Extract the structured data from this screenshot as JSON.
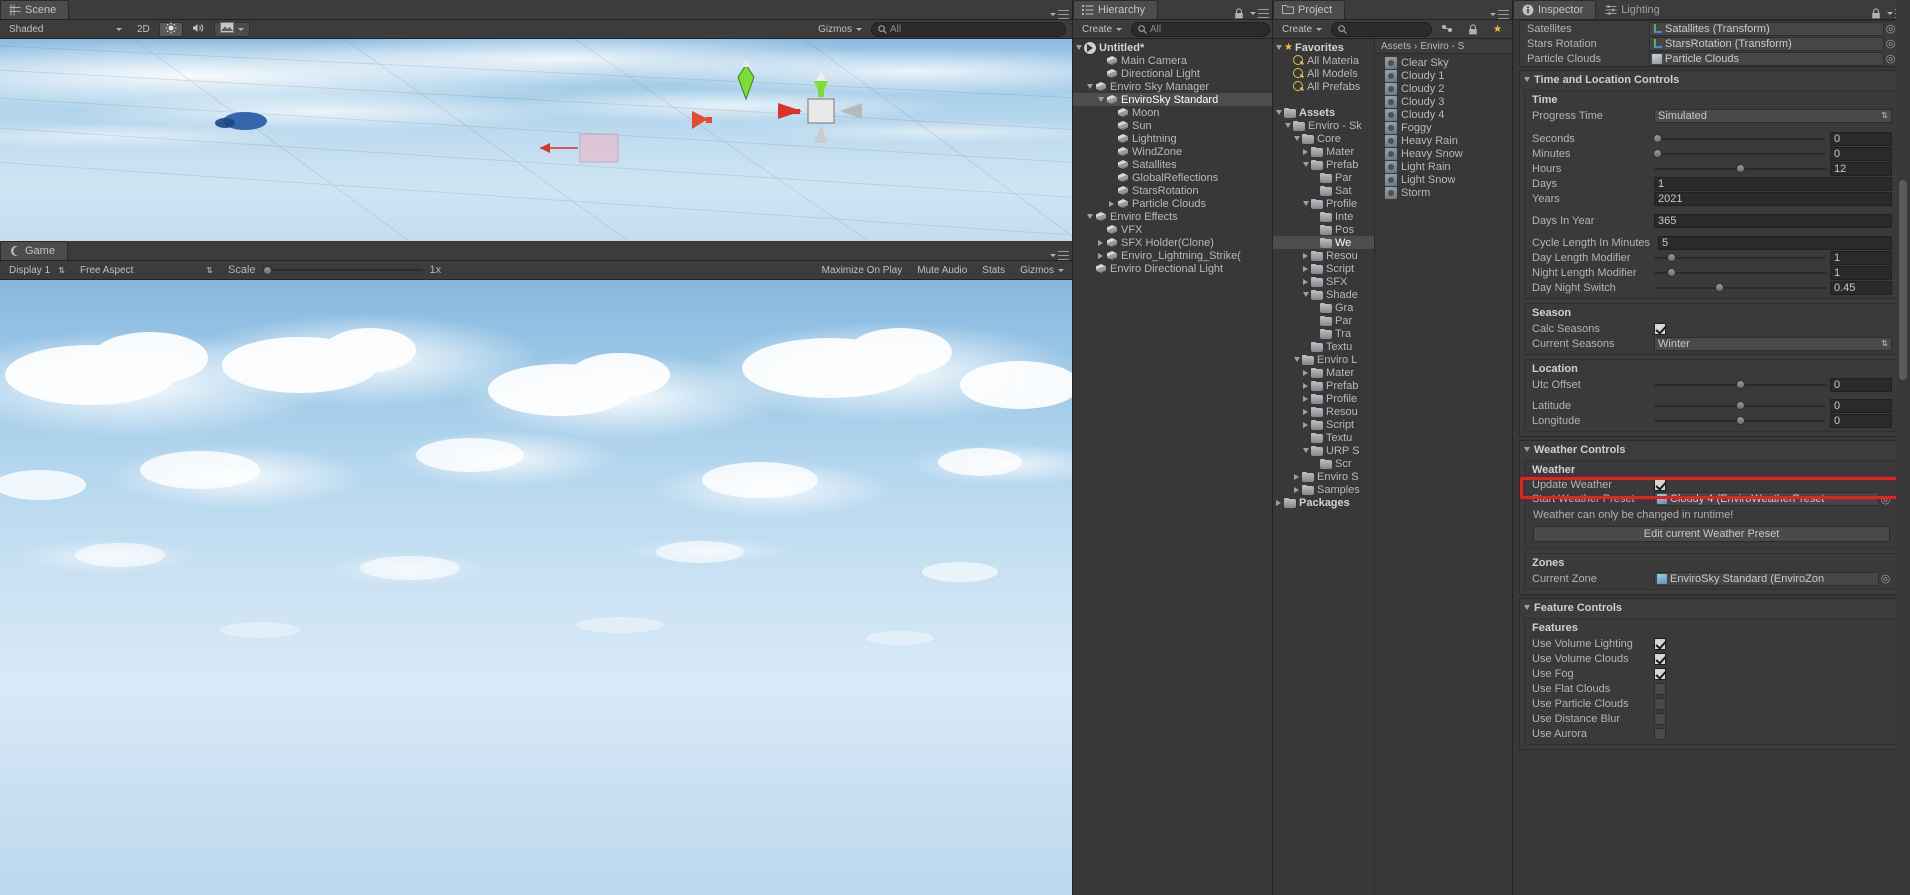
{
  "scene_view": {
    "tab_label": "Scene",
    "tab_icon": "scene-grid-icon",
    "draw_mode": "Shaded",
    "two_d_button": "2D",
    "lighting_icon": "sun-icon",
    "audio_icon": "speaker-icon",
    "fx_icon": "image-icon",
    "gizmos_label": "Gizmos",
    "search_placeholder": "All",
    "search_value": ""
  },
  "game_view": {
    "tab_label": "Game",
    "tab_icon": "gamepad-icon",
    "display": "Display 1",
    "aspect": "Free Aspect",
    "scale_label": "Scale",
    "scale_value": "1x",
    "maximize_on_play": "Maximize On Play",
    "mute_audio": "Mute Audio",
    "stats": "Stats",
    "gizmos": "Gizmos"
  },
  "hierarchy": {
    "tab_label": "Hierarchy",
    "tab_icon": "hierarchy-icon",
    "create_label": "Create",
    "search_placeholder": "All",
    "items": [
      {
        "label": "Untitled*",
        "depth": 0,
        "icon": "unity-scene-icon",
        "fold": "down",
        "selected": false,
        "bold": true
      },
      {
        "label": "Main Camera",
        "depth": 2,
        "icon": "gameobject-icon",
        "fold": "none",
        "selected": false
      },
      {
        "label": "Directional Light",
        "depth": 2,
        "icon": "gameobject-icon",
        "fold": "none",
        "selected": false
      },
      {
        "label": "Enviro Sky Manager",
        "depth": 1,
        "icon": "gameobject-icon",
        "fold": "down",
        "selected": false
      },
      {
        "label": "EnviroSky Standard",
        "depth": 2,
        "icon": "gameobject-icon",
        "fold": "down",
        "selected": true
      },
      {
        "label": "Moon",
        "depth": 3,
        "icon": "gameobject-icon",
        "fold": "none",
        "selected": false
      },
      {
        "label": "Sun",
        "depth": 3,
        "icon": "gameobject-icon",
        "fold": "none",
        "selected": false
      },
      {
        "label": "Lightning",
        "depth": 3,
        "icon": "gameobject-icon",
        "fold": "none",
        "selected": false
      },
      {
        "label": "WindZone",
        "depth": 3,
        "icon": "gameobject-icon",
        "fold": "none",
        "selected": false
      },
      {
        "label": "Satallites",
        "depth": 3,
        "icon": "gameobject-icon",
        "fold": "none",
        "selected": false
      },
      {
        "label": "GlobalReflections",
        "depth": 3,
        "icon": "gameobject-icon",
        "fold": "none",
        "selected": false
      },
      {
        "label": "StarsRotation",
        "depth": 3,
        "icon": "gameobject-icon",
        "fold": "none",
        "selected": false
      },
      {
        "label": "Particle Clouds",
        "depth": 3,
        "icon": "gameobject-icon",
        "fold": "right",
        "selected": false
      },
      {
        "label": "Enviro Effects",
        "depth": 1,
        "icon": "gameobject-icon",
        "fold": "down",
        "selected": false
      },
      {
        "label": "VFX",
        "depth": 2,
        "icon": "gameobject-icon",
        "fold": "none",
        "selected": false
      },
      {
        "label": "SFX Holder(Clone)",
        "depth": 2,
        "icon": "gameobject-icon",
        "fold": "right",
        "selected": false
      },
      {
        "label": "Enviro_Lightning_Strike(",
        "depth": 2,
        "icon": "gameobject-icon",
        "fold": "right",
        "selected": false
      },
      {
        "label": "Enviro Directional Light",
        "depth": 1,
        "icon": "gameobject-icon",
        "fold": "none",
        "selected": false
      }
    ]
  },
  "project": {
    "tab_label": "Project",
    "tab_icon": "folder-icon",
    "create_label": "Create",
    "search_placeholder": "",
    "breadcrumb": [
      "Assets",
      "Enviro - S"
    ],
    "tree": [
      {
        "label": "Favorites",
        "depth": 0,
        "icon": "star-icon",
        "fold": "down",
        "bold": true
      },
      {
        "label": "All Materia",
        "depth": 1,
        "icon": "search-icon",
        "fold": "none"
      },
      {
        "label": "All Models",
        "depth": 1,
        "icon": "search-icon",
        "fold": "none"
      },
      {
        "label": "All Prefabs",
        "depth": 1,
        "icon": "search-icon",
        "fold": "none"
      },
      {
        "label": "",
        "depth": 0,
        "icon": "none",
        "fold": "none"
      },
      {
        "label": "Assets",
        "depth": 0,
        "icon": "folder-icon",
        "fold": "down",
        "bold": true
      },
      {
        "label": "Enviro - Sk",
        "depth": 1,
        "icon": "folder-icon",
        "fold": "down"
      },
      {
        "label": "Core",
        "depth": 2,
        "icon": "folder-icon",
        "fold": "down"
      },
      {
        "label": "Mater",
        "depth": 3,
        "icon": "folder-icon",
        "fold": "right"
      },
      {
        "label": "Prefab",
        "depth": 3,
        "icon": "folder-icon",
        "fold": "down"
      },
      {
        "label": "Par",
        "depth": 4,
        "icon": "folder-icon",
        "fold": "none"
      },
      {
        "label": "Sat",
        "depth": 4,
        "icon": "folder-icon",
        "fold": "none"
      },
      {
        "label": "Profile",
        "depth": 3,
        "icon": "folder-icon",
        "fold": "down"
      },
      {
        "label": "Inte",
        "depth": 4,
        "icon": "folder-icon",
        "fold": "none"
      },
      {
        "label": "Pos",
        "depth": 4,
        "icon": "folder-icon",
        "fold": "none"
      },
      {
        "label": "We",
        "depth": 4,
        "icon": "folder-icon",
        "fold": "none",
        "selected": true
      },
      {
        "label": "Resou",
        "depth": 3,
        "icon": "folder-icon",
        "fold": "right"
      },
      {
        "label": "Script",
        "depth": 3,
        "icon": "folder-icon",
        "fold": "right"
      },
      {
        "label": "SFX",
        "depth": 3,
        "icon": "folder-icon",
        "fold": "right"
      },
      {
        "label": "Shade",
        "depth": 3,
        "icon": "folder-icon",
        "fold": "down"
      },
      {
        "label": "Gra",
        "depth": 4,
        "icon": "folder-icon",
        "fold": "none"
      },
      {
        "label": "Par",
        "depth": 4,
        "icon": "folder-icon",
        "fold": "none"
      },
      {
        "label": "Tra",
        "depth": 4,
        "icon": "folder-icon",
        "fold": "none"
      },
      {
        "label": "Textu",
        "depth": 3,
        "icon": "folder-icon",
        "fold": "none"
      },
      {
        "label": "Enviro L",
        "depth": 2,
        "icon": "folder-icon",
        "fold": "down"
      },
      {
        "label": "Mater",
        "depth": 3,
        "icon": "folder-icon",
        "fold": "right"
      },
      {
        "label": "Prefab",
        "depth": 3,
        "icon": "folder-icon",
        "fold": "right"
      },
      {
        "label": "Profile",
        "depth": 3,
        "icon": "folder-icon",
        "fold": "right"
      },
      {
        "label": "Resou",
        "depth": 3,
        "icon": "folder-icon",
        "fold": "right"
      },
      {
        "label": "Script",
        "depth": 3,
        "icon": "folder-icon",
        "fold": "right"
      },
      {
        "label": "Textu",
        "depth": 3,
        "icon": "folder-icon",
        "fold": "none"
      },
      {
        "label": "URP S",
        "depth": 3,
        "icon": "folder-icon",
        "fold": "down"
      },
      {
        "label": "Scr",
        "depth": 4,
        "icon": "folder-icon",
        "fold": "none"
      },
      {
        "label": "Enviro S",
        "depth": 2,
        "icon": "folder-icon",
        "fold": "right"
      },
      {
        "label": "Samples",
        "depth": 2,
        "icon": "folder-icon",
        "fold": "right"
      },
      {
        "label": "Packages",
        "depth": 0,
        "icon": "folder-icon",
        "fold": "right",
        "bold": true
      }
    ],
    "assets": [
      {
        "label": "Clear Sky",
        "icon": "scriptable-object-icon"
      },
      {
        "label": "Cloudy 1",
        "icon": "scriptable-object-icon"
      },
      {
        "label": "Cloudy 2",
        "icon": "scriptable-object-icon"
      },
      {
        "label": "Cloudy 3",
        "icon": "scriptable-object-icon"
      },
      {
        "label": "Cloudy 4",
        "icon": "scriptable-object-icon"
      },
      {
        "label": "Foggy",
        "icon": "scriptable-object-icon"
      },
      {
        "label": "Heavy Rain",
        "icon": "scriptable-object-icon"
      },
      {
        "label": "Heavy Snow",
        "icon": "scriptable-object-icon"
      },
      {
        "label": "Light Rain",
        "icon": "scriptable-object-icon"
      },
      {
        "label": "Light Snow",
        "icon": "scriptable-object-icon"
      },
      {
        "label": "Storm",
        "icon": "scriptable-object-icon"
      }
    ]
  },
  "inspector": {
    "tab_label": "Inspector",
    "tab_icon": "info-icon",
    "lighting_tab_label": "Lighting",
    "lighting_tab_icon": "lighting-icon",
    "top_object_fields": [
      {
        "label": "Satellites",
        "value": "Satallites (Transform)",
        "icon": "transform-icon"
      },
      {
        "label": "Stars Rotation",
        "value": "StarsRotation (Transform)",
        "icon": "transform-icon"
      },
      {
        "label": "Particle Clouds",
        "value": "Particle Clouds",
        "icon": "gameobject-icon"
      }
    ],
    "time_and_location": {
      "header": "Time and Location Controls",
      "time_title": "Time",
      "progress_time_label": "Progress Time",
      "progress_time_value": "Simulated",
      "sliders": [
        {
          "label": "Seconds",
          "value": "0",
          "pos": 2
        },
        {
          "label": "Minutes",
          "value": "0",
          "pos": 2
        },
        {
          "label": "Hours",
          "value": "12",
          "pos": 50
        }
      ],
      "fields": [
        {
          "label": "Days",
          "value": "1"
        },
        {
          "label": "Years",
          "value": "2021"
        }
      ],
      "days_in_year_label": "Days In Year",
      "days_in_year_value": "365",
      "cycle_length_label": "Cycle Length In Minutes",
      "cycle_length_value": "5",
      "modifiers": [
        {
          "label": "Day Length Modifier",
          "value": "1",
          "pos": 10
        },
        {
          "label": "Night Length Modifier",
          "value": "1",
          "pos": 10
        },
        {
          "label": "Day Night Switch",
          "value": "0.45",
          "pos": 38
        }
      ],
      "season_title": "Season",
      "calc_seasons_label": "Calc Seasons",
      "calc_seasons_checked": true,
      "current_seasons_label": "Current Seasons",
      "current_seasons_value": "Winter",
      "location_title": "Location",
      "location_sliders": [
        {
          "label": "Utc Offset",
          "value": "0",
          "pos": 50
        },
        {
          "label": "Latitude",
          "value": "0",
          "pos": 50
        },
        {
          "label": "Longitude",
          "value": "0",
          "pos": 50
        }
      ]
    },
    "weather_controls": {
      "header": "Weather Controls",
      "weather_title": "Weather",
      "update_weather_label": "Update Weather",
      "update_weather_checked": true,
      "start_weather_preset_label": "Start Weather Preset",
      "start_weather_preset_value": "Cloudy 4 (EnviroWeatherPreset",
      "runtime_hint": "Weather can only be changed in runtime!",
      "edit_preset_button": "Edit current Weather Preset",
      "zones_title": "Zones",
      "current_zone_label": "Current Zone",
      "current_zone_value": "EnviroSky Standard (EnviroZon",
      "highlight_color": "#ee1c24"
    },
    "feature_controls": {
      "header": "Feature Controls",
      "features_title": "Features",
      "features": [
        {
          "label": "Use Volume Lighting",
          "checked": true
        },
        {
          "label": "Use Volume Clouds",
          "checked": true
        },
        {
          "label": "Use Fog",
          "checked": true
        },
        {
          "label": "Use Flat Clouds",
          "checked": false
        },
        {
          "label": "Use Particle Clouds",
          "checked": false
        },
        {
          "label": "Use Distance Blur",
          "checked": false
        },
        {
          "label": "Use Aurora",
          "checked": false
        }
      ]
    }
  }
}
